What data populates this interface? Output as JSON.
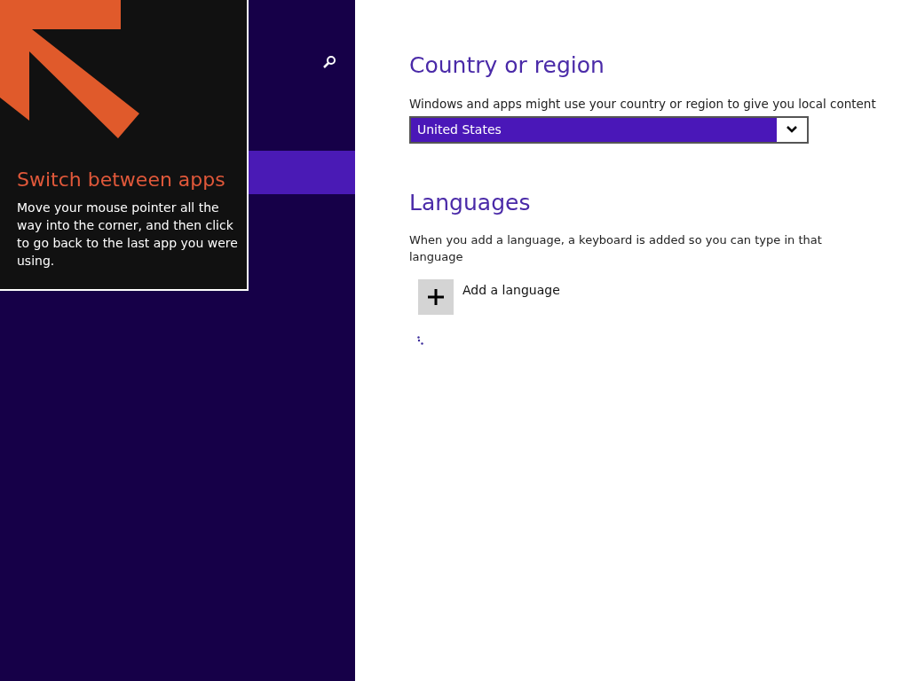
{
  "tip": {
    "title": "Switch between apps",
    "body": "Move your mouse pointer all the way into the corner, and then click to go back to the last app you were using."
  },
  "country": {
    "heading": "Country or region",
    "description": "Windows and apps might use your country or region to give you local content",
    "value": "United States"
  },
  "languages": {
    "heading": "Languages",
    "description": "When you add a language, a keyboard is added so you can type in that language",
    "add_label": "Add a language",
    "loading": true
  }
}
